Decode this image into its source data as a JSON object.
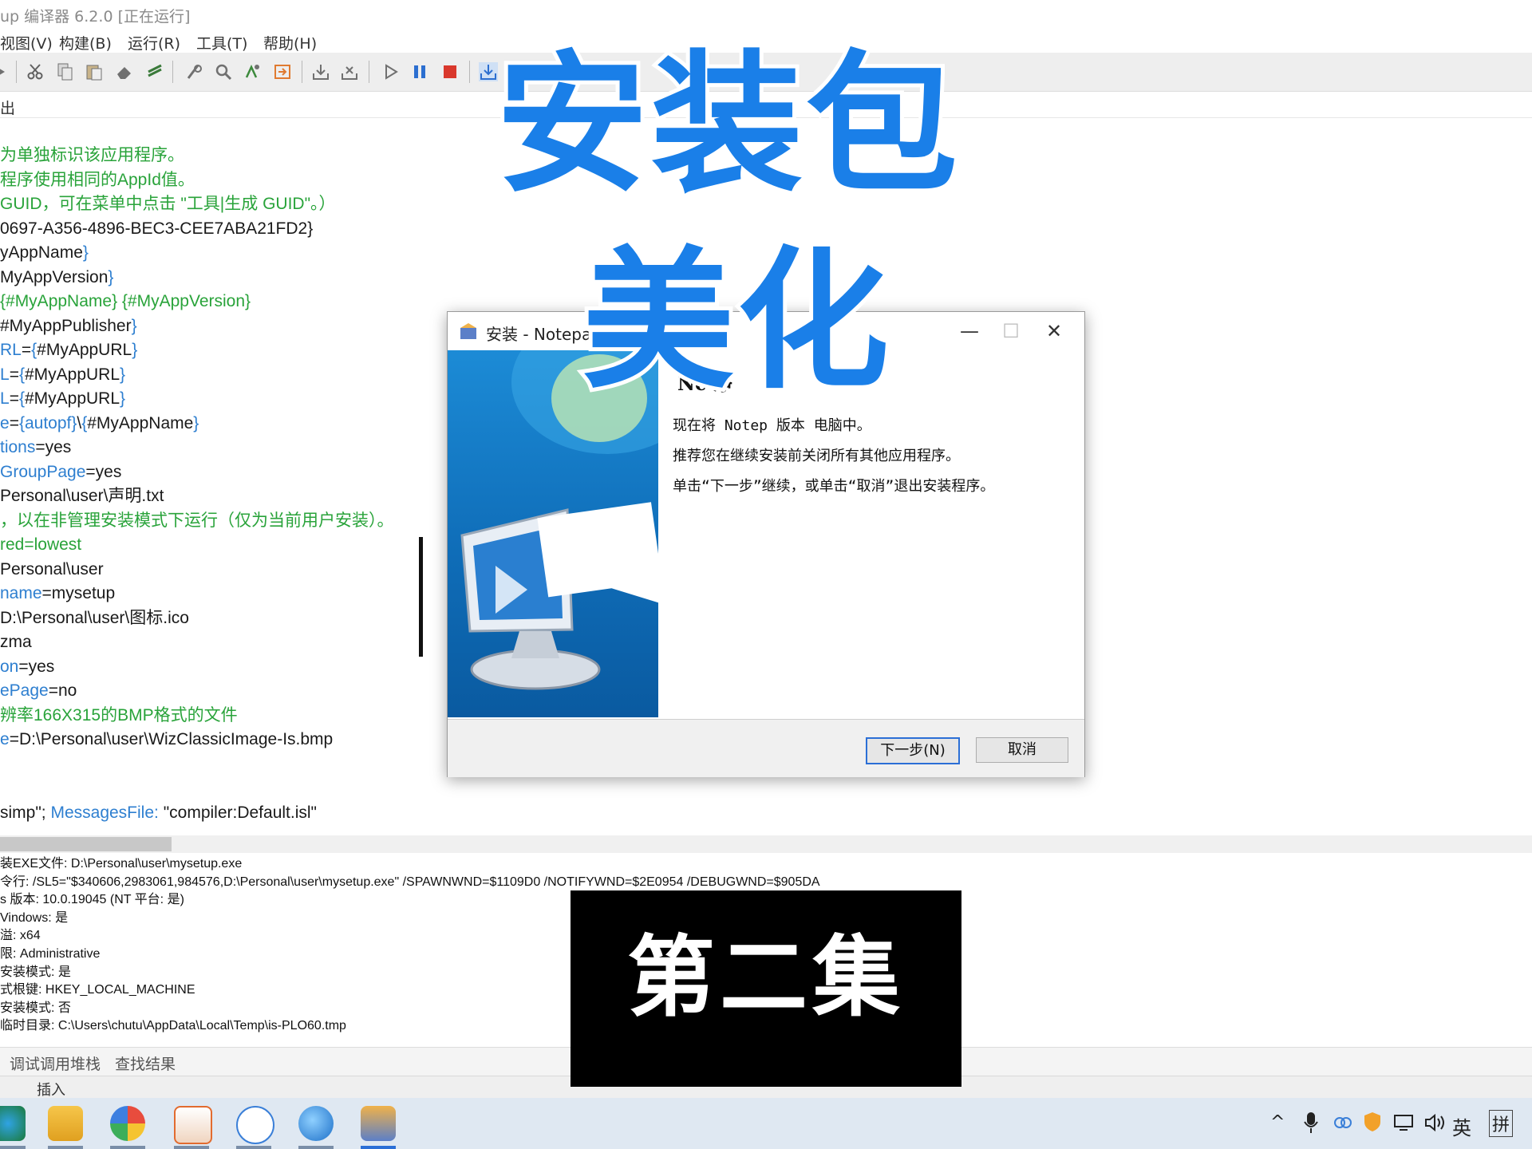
{
  "window": {
    "title": "up 编译器 6.2.0 [正在运行]"
  },
  "menu": [
    "视图(V)",
    "构建(B)",
    "运行(R)",
    "工具(T)",
    "帮助(H)"
  ],
  "tabstrip": {
    "label": "出"
  },
  "editor_lines": [
    [
      {
        "c": "cm",
        "t": "为单独标识该应用程序。"
      }
    ],
    [
      {
        "c": "cm",
        "t": "程序使用相同的AppId值。"
      }
    ],
    [
      {
        "c": "cm",
        "t": "GUID，可在菜单中点击 \"工具|生成 GUID\"。）"
      }
    ],
    [
      {
        "c": "tx",
        "t": "0697-A356-4896-BEC3-CEE7ABA21FD2}"
      }
    ],
    [
      {
        "c": "tx",
        "t": "yAppName"
      },
      {
        "c": "kw",
        "t": "}"
      }
    ],
    [
      {
        "c": "tx",
        "t": "MyAppVersion"
      },
      {
        "c": "kw",
        "t": "}"
      }
    ],
    [
      {
        "c": "cm",
        "t": "{#MyAppName} {#MyAppVersion}"
      }
    ],
    [
      {
        "c": "tx",
        "t": "#MyAppPublisher"
      },
      {
        "c": "kw",
        "t": "}"
      }
    ],
    [
      {
        "c": "kw",
        "t": "RL"
      },
      {
        "c": "tx",
        "t": "="
      },
      {
        "c": "kw",
        "t": "{"
      },
      {
        "c": "tx",
        "t": "#MyAppURL"
      },
      {
        "c": "kw",
        "t": "}"
      }
    ],
    [
      {
        "c": "kw",
        "t": "L"
      },
      {
        "c": "tx",
        "t": "="
      },
      {
        "c": "kw",
        "t": "{"
      },
      {
        "c": "tx",
        "t": "#MyAppURL"
      },
      {
        "c": "kw",
        "t": "}"
      }
    ],
    [
      {
        "c": "kw",
        "t": "L"
      },
      {
        "c": "tx",
        "t": "="
      },
      {
        "c": "kw",
        "t": "{"
      },
      {
        "c": "tx",
        "t": "#MyAppURL"
      },
      {
        "c": "kw",
        "t": "}"
      }
    ],
    [
      {
        "c": "kw",
        "t": "e"
      },
      {
        "c": "tx",
        "t": "="
      },
      {
        "c": "kw",
        "t": "{autopf}"
      },
      {
        "c": "tx",
        "t": "\\"
      },
      {
        "c": "kw",
        "t": "{"
      },
      {
        "c": "tx",
        "t": "#MyAppName"
      },
      {
        "c": "kw",
        "t": "}"
      }
    ],
    [
      {
        "c": "kw",
        "t": "tions"
      },
      {
        "c": "tx",
        "t": "=yes"
      }
    ],
    [
      {
        "c": "kw",
        "t": "GroupPage"
      },
      {
        "c": "tx",
        "t": "=yes"
      }
    ],
    [
      {
        "c": "tx",
        "t": "Personal\\user\\声明.txt"
      }
    ],
    [
      {
        "c": "cm",
        "t": "，以在非管理安装模式下运行（仅为当前用户安装）。"
      }
    ],
    [
      {
        "c": "cm",
        "t": "red=lowest"
      }
    ],
    [
      {
        "c": "tx",
        "t": "Personal\\user"
      }
    ],
    [
      {
        "c": "kw",
        "t": "name"
      },
      {
        "c": "tx",
        "t": "=mysetup"
      }
    ],
    [
      {
        "c": "tx",
        "t": "D:\\Personal\\user\\图标.ico"
      }
    ],
    [
      {
        "c": "tx",
        "t": "zma"
      }
    ],
    [
      {
        "c": "kw",
        "t": "on"
      },
      {
        "c": "tx",
        "t": "=yes"
      }
    ],
    [
      {
        "c": "kw",
        "t": "ePage"
      },
      {
        "c": "tx",
        "t": "=no"
      }
    ],
    [
      {
        "c": "cm",
        "t": "辨率166X315的BMP格式的文件"
      }
    ],
    [
      {
        "c": "kw",
        "t": "e"
      },
      {
        "c": "tx",
        "t": "=D:\\Personal\\user\\WizClassicImage-Is.bmp"
      }
    ],
    [],
    [],
    [
      {
        "c": "tx",
        "t": "simp\"; "
      },
      {
        "c": "kw",
        "t": "MessagesFile:"
      },
      {
        "c": "tx",
        "t": " \"compiler:Default.isl\""
      }
    ]
  ],
  "output_lines": [
    "装EXE文件: D:\\Personal\\user\\mysetup.exe",
    "令行: /SL5=\"$340606,2983061,984576,D:\\Personal\\user\\mysetup.exe\" /SPAWNWND=$1109D0 /NOTIFYWND=$2E0954 /DEBUGWND=$905DA",
    "s 版本: 10.0.19045  (NT 平台: 是)",
    "Vindows: 是",
    "溢: x64",
    "限: Administrative",
    "安装模式: 是",
    "式根键: HKEY_LOCAL_MACHINE",
    "安装模式: 否",
    "临时目录: C:\\Users\\chutu\\AppData\\Local\\Temp\\is-PLO60.tmp"
  ],
  "output_tabs": [
    "调试调用堆栈",
    "查找结果"
  ],
  "statusbar": {
    "mode": "插入"
  },
  "dialog": {
    "title": "安装 - Notepa",
    "heading": "Nc           净",
    "lines": [
      "现在将     Notep    版本          电脑中。",
      "推荐您在继续安装前关闭所有其他应用程序。",
      "单击“下一步”继续，或单击“取消”退出安装程序。"
    ],
    "next_label": "下一步(N)",
    "cancel_label": "取消",
    "close_glyph": "✕",
    "minimize_glyph": "—",
    "maximize_glyph": "☐"
  },
  "overlay": {
    "title_line1": "安装包",
    "title_line2": "美化",
    "episode": "第二集",
    "title_color": "#1a7fe8"
  },
  "tray": {
    "ime": "英",
    "ime2": "拼",
    "caret": "^"
  },
  "colors": {
    "comment": "#29a33a",
    "keyword": "#2e7fd0",
    "accent": "#2b6fd6"
  }
}
